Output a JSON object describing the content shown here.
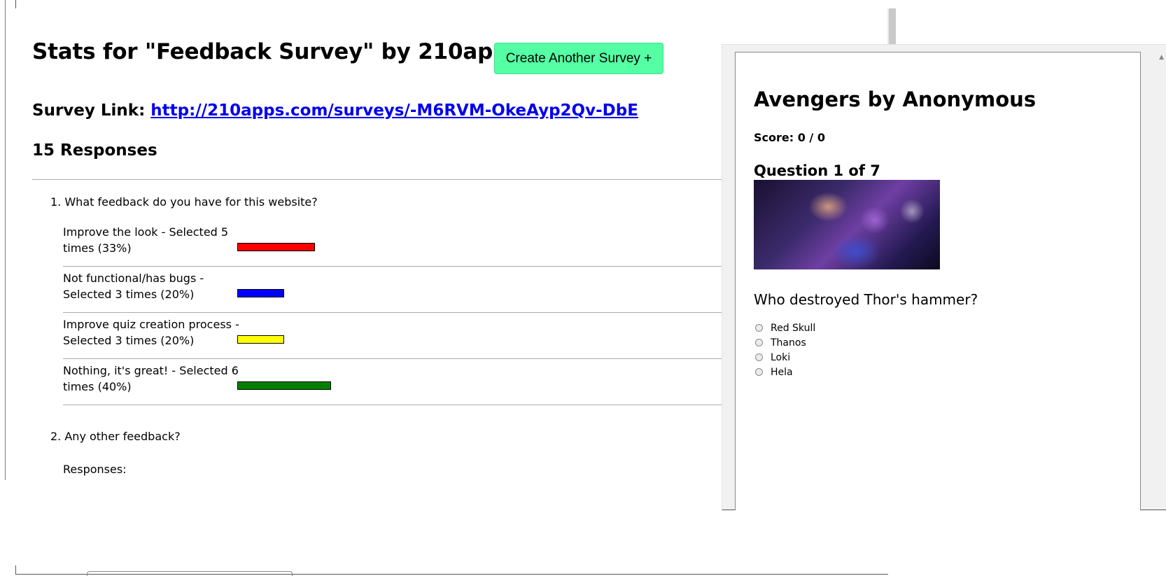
{
  "stats": {
    "title": "Stats for \"Feedback Survey\" by 210apps.com",
    "create_button": "Create Another Survey +",
    "survey_link_label": "Survey Link:",
    "survey_link_url": "http://210apps.com/surveys/-M6RVM-OkeAyp2Qv-DbE",
    "responses_count": "15 Responses",
    "questions": [
      {
        "text": "1. What feedback do you have for this website?",
        "options": [
          {
            "label": "Improve the look - Selected 5 times (33%)",
            "count": 5,
            "percent": 33,
            "color": "#ff0000"
          },
          {
            "label": "Not functional/has bugs - Selected 3 times (20%)",
            "count": 3,
            "percent": 20,
            "color": "#0000ff"
          },
          {
            "label": "Improve quiz creation process - Selected 3 times (20%)",
            "count": 3,
            "percent": 20,
            "color": "#ffff00"
          },
          {
            "label": "Nothing, it's great! - Selected 6 times (40%)",
            "count": 6,
            "percent": 40,
            "color": "#008000"
          }
        ]
      },
      {
        "text": "2. Any other feedback?",
        "responses_label": "Responses:"
      }
    ]
  },
  "quiz": {
    "title": "Avengers by Anonymous",
    "score": "Score: 0 / 0",
    "question_number": "Question 1 of 7",
    "question": "Who destroyed Thor's hammer?",
    "options": [
      "Red Skull",
      "Thanos",
      "Loki",
      "Hela"
    ]
  }
}
